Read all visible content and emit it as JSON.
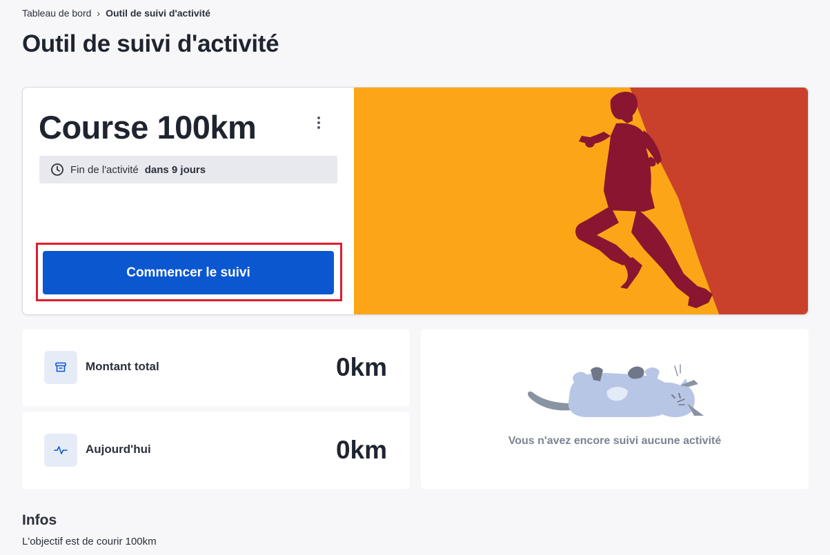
{
  "breadcrumb": {
    "parent": "Tableau de bord",
    "current": "Outil de suivi d'activité"
  },
  "page_title": "Outil de suivi d'activité",
  "activity": {
    "title": "Course 100km",
    "end_prefix": "Fin de l'activité",
    "end_value": "dans 9 jours",
    "start_button": "Commencer le suivi"
  },
  "stats": {
    "total": {
      "label": "Montant total",
      "value": "0km",
      "icon": "archive-icon"
    },
    "today": {
      "label": "Aujourd'hui",
      "value": "0km",
      "icon": "activity-pulse-icon"
    }
  },
  "empty_state": {
    "message": "Vous n'avez encore suivi aucune activité"
  },
  "infos": {
    "title": "Infos",
    "text": "L'objectif est de courir 100km"
  },
  "colors": {
    "accent": "#0b57d0",
    "highlight": "#e01b2b",
    "hero_orange": "#fca617",
    "hero_red": "#c9412a",
    "runner": "#8a1530"
  }
}
